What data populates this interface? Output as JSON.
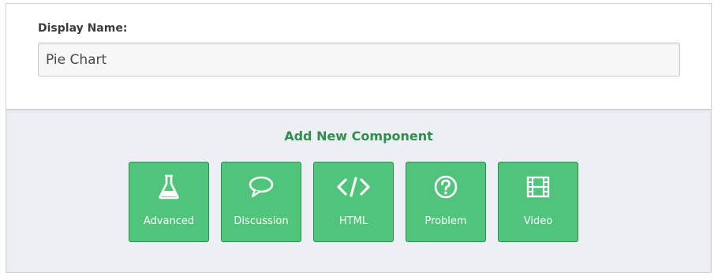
{
  "editor": {
    "display_name_label": "Display Name:",
    "display_name_value": "Pie Chart"
  },
  "add_component": {
    "title": "Add New Component",
    "buttons": [
      {
        "label": "Advanced",
        "icon": "flask-icon"
      },
      {
        "label": "Discussion",
        "icon": "speech-bubble-icon"
      },
      {
        "label": "HTML",
        "icon": "code-icon"
      },
      {
        "label": "Problem",
        "icon": "question-circle-icon"
      },
      {
        "label": "Video",
        "icon": "film-icon"
      }
    ]
  },
  "colors": {
    "button_bg": "#4fc47a",
    "button_border": "#2e8e52",
    "title_green": "#2f8f4b",
    "panel_bg": "#eceff4"
  }
}
